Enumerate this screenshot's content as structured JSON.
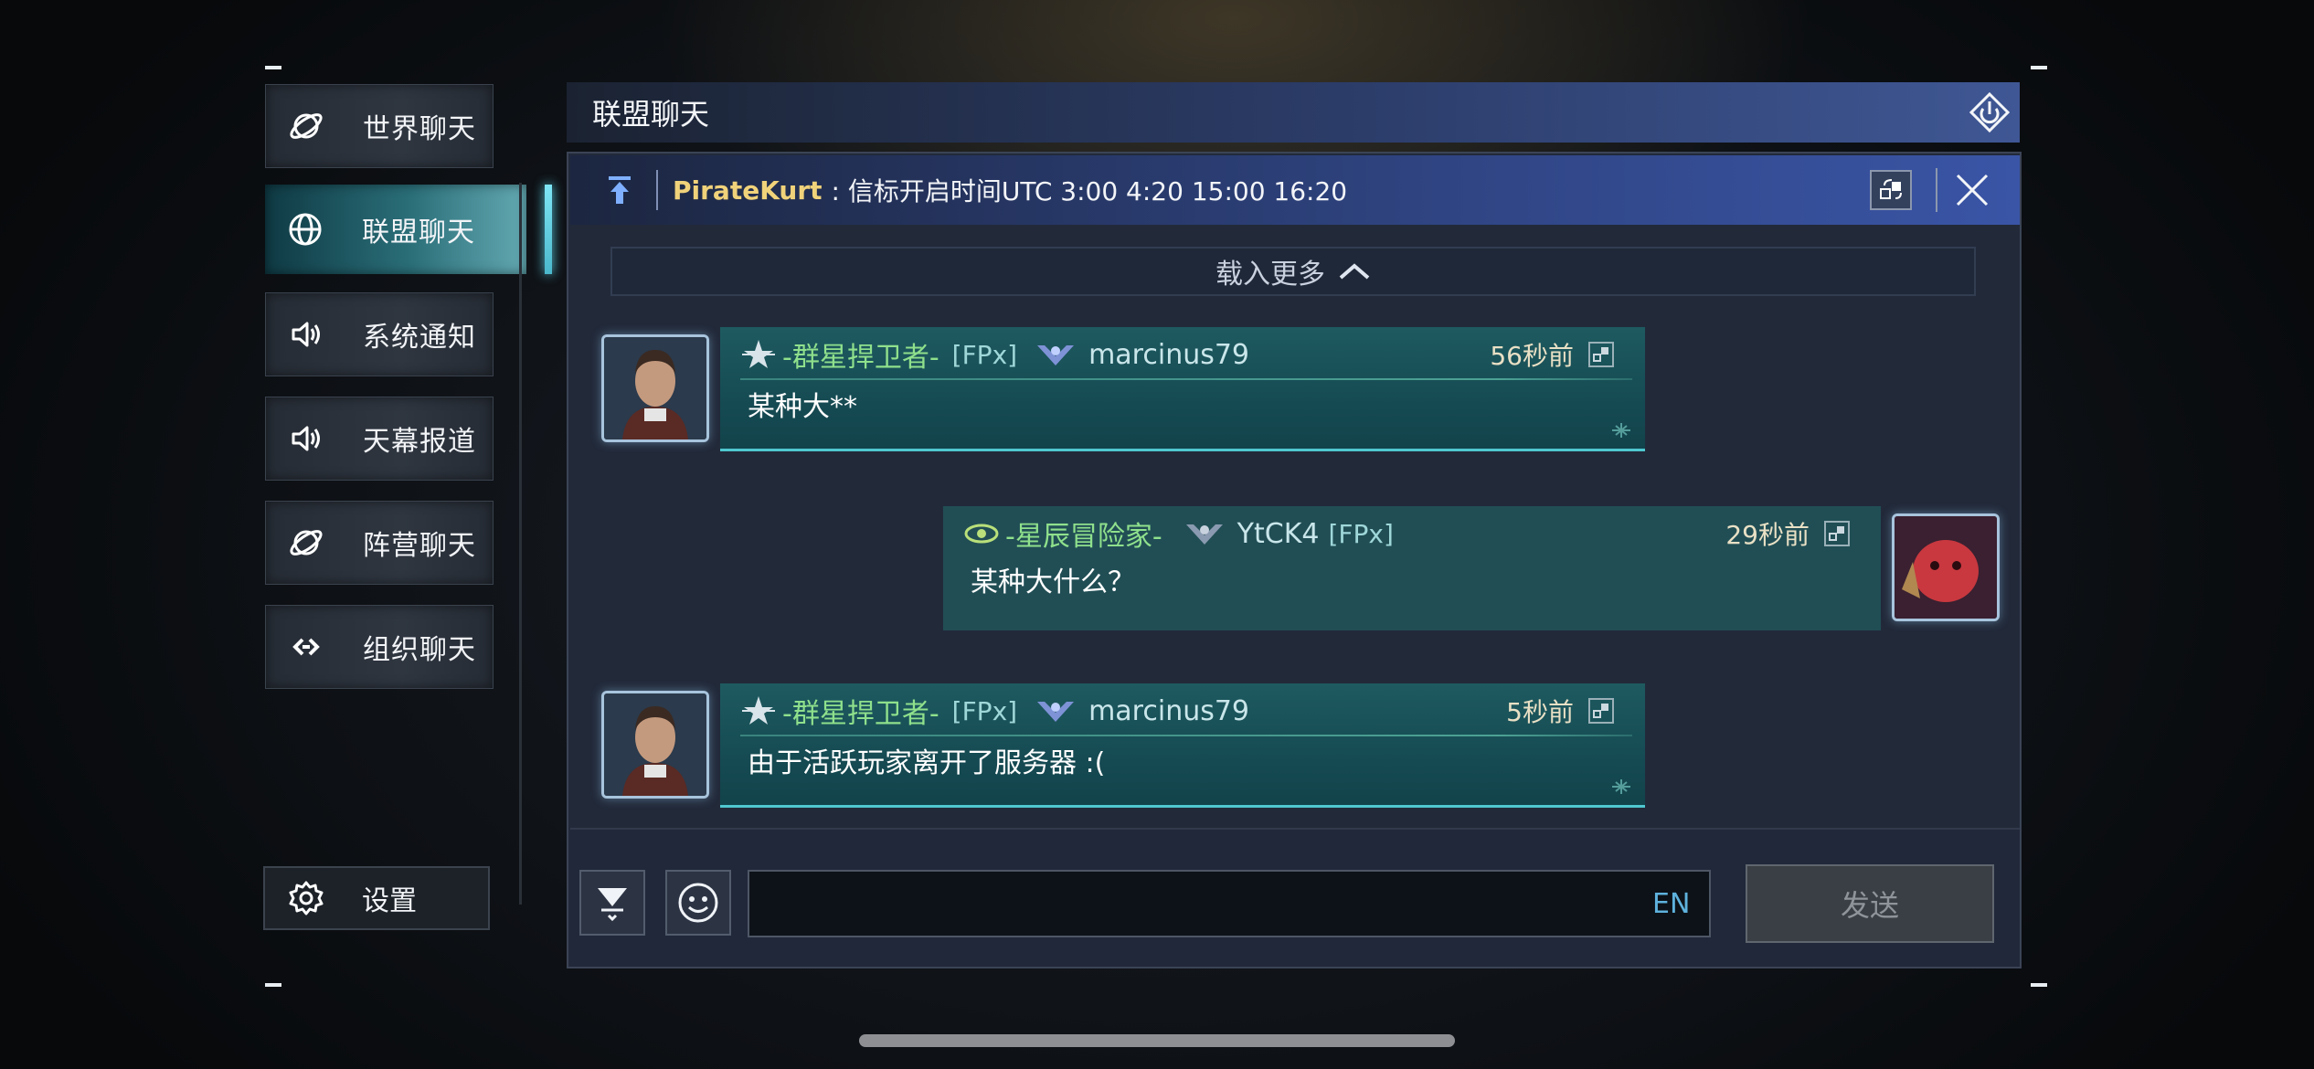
{
  "sidebar": {
    "items": [
      {
        "label": "世界聊天",
        "icon": "planet-icon"
      },
      {
        "label": "联盟聊天",
        "icon": "globe-icon"
      },
      {
        "label": "系统通知",
        "icon": "speaker-icon"
      },
      {
        "label": "天幕报道",
        "icon": "speaker-icon"
      },
      {
        "label": "阵营聊天",
        "icon": "planet-icon"
      },
      {
        "label": "组织聊天",
        "icon": "link-icon"
      }
    ],
    "active_index": 1,
    "settings_label": "设置"
  },
  "header": {
    "title": "联盟聊天"
  },
  "pinned": {
    "author": "PirateKurt",
    "message": ": 信标开启时间UTC 3:00 4:20 15:00 16:20"
  },
  "load_more_label": "载入更多",
  "messages": [
    {
      "side": "left",
      "rank": "-群星捍卫者-",
      "tag": "[FPx]",
      "name": "marcinus79",
      "time": "56秒前",
      "text": "某种大**"
    },
    {
      "side": "right",
      "rank": "-星辰冒险家-",
      "tag": "[FPx]",
      "name": "YtCK4",
      "time": "29秒前",
      "text": "某种大什么？"
    },
    {
      "side": "left",
      "rank": "-群星捍卫者-",
      "tag": "[FPx]",
      "name": "marcinus79",
      "time": "5秒前",
      "text": "由于活跃玩家离开了服务器 :("
    }
  ],
  "input": {
    "value": "",
    "placeholder": "",
    "lang": "EN"
  },
  "send_label": "发送",
  "colors": {
    "accent": "#4fc7cf",
    "rank": "#8fe08c",
    "pinned_author": "#f0d27a"
  }
}
